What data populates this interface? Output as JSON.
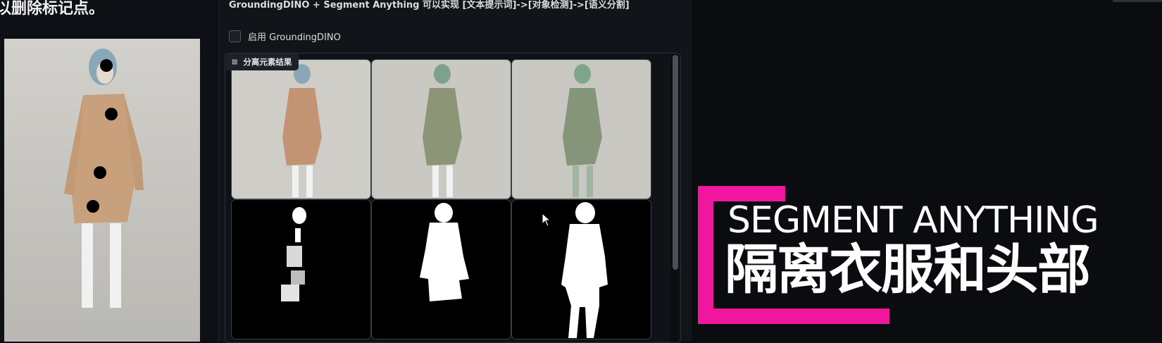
{
  "left": {
    "instruction_text": "以删除标记点。"
  },
  "middle": {
    "description": "GroundingDINO + Segment Anything 可以实现 [文本提示词]->[对象检测]->[语义分割]",
    "checkbox_label": "启用 GroundingDINO",
    "checkbox_checked": false,
    "gallery_label": "分离元素结果"
  },
  "overlay": {
    "title_en": "SEGMENT ANYTHING",
    "title_cn": "隔离衣服和头部",
    "accent_color": "#f0179e"
  }
}
